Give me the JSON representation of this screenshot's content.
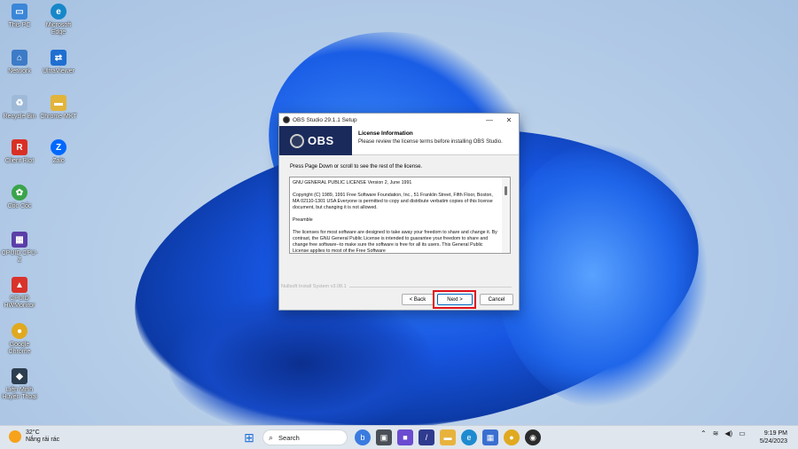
{
  "desktop_icons": [
    {
      "label": "This PC",
      "color": "#3a86d8"
    },
    {
      "label": "Microsoft Edge",
      "color": "#1787c9"
    },
    {
      "label": "Network",
      "color": "#3d7bc7"
    },
    {
      "label": "UltraViewer",
      "color": "#1f6fd1"
    },
    {
      "label": "Recycle Bin",
      "color": "#9fbad8"
    },
    {
      "label": "Chrome MKT",
      "color": "#e2b43a"
    },
    {
      "label": "Client Rlot",
      "color": "#d93025"
    },
    {
      "label": "Zalo",
      "color": "#0068ff"
    },
    {
      "label": "Cốc Cốc",
      "color": "#3aa44b"
    },
    {
      "label": "CPUID CPU-Z",
      "color": "#5b3ea8"
    },
    {
      "label": "CPUID HWMonitor",
      "color": "#d9332b"
    },
    {
      "label": "Google Chrome",
      "color": "#e0a91f"
    },
    {
      "label": "Liên Minh Huyền Thoại",
      "color": "#2c3e4f"
    }
  ],
  "window": {
    "title": "OBS Studio 29.1.1 Setup",
    "logo_text": "OBS",
    "header_title": "License Information",
    "header_subtitle": "Please review the license terms before installing OBS Studio.",
    "instructions": "Press Page Down or scroll to see the rest of the license.",
    "license_paragraphs": [
      "GNU GENERAL PUBLIC LICENSE Version 2, June 1991",
      "Copyright (C) 1989, 1991 Free Software Foundation, Inc., 51 Franklin Street, Fifth Floor, Boston, MA 02110-1301 USA Everyone is permitted to copy and distribute verbatim copies of this license document, but changing it is not allowed.",
      "Preamble",
      "The licenses for most software are designed to take away your freedom to share and change it. By contrast, the GNU General Public License is intended to guarantee your freedom to share and change free software--to make sure the software is free for all its users. This General Public License applies to most of the Free Software"
    ],
    "nsis_text": "Nullsoft Install System v3.08.1",
    "back_label": "< Back",
    "next_label": "Next >",
    "cancel_label": "Cancel",
    "minimize_glyph": "—",
    "close_glyph": "✕"
  },
  "taskbar": {
    "weather_temp": "32°C",
    "weather_desc": "Nắng rải rác",
    "search_label": "Search",
    "time": "9:19 PM",
    "date": "5/24/2023"
  },
  "colors": {
    "obs_header": "#1a2a5b",
    "highlight": "#e0121b",
    "accent": "#0067c0"
  }
}
